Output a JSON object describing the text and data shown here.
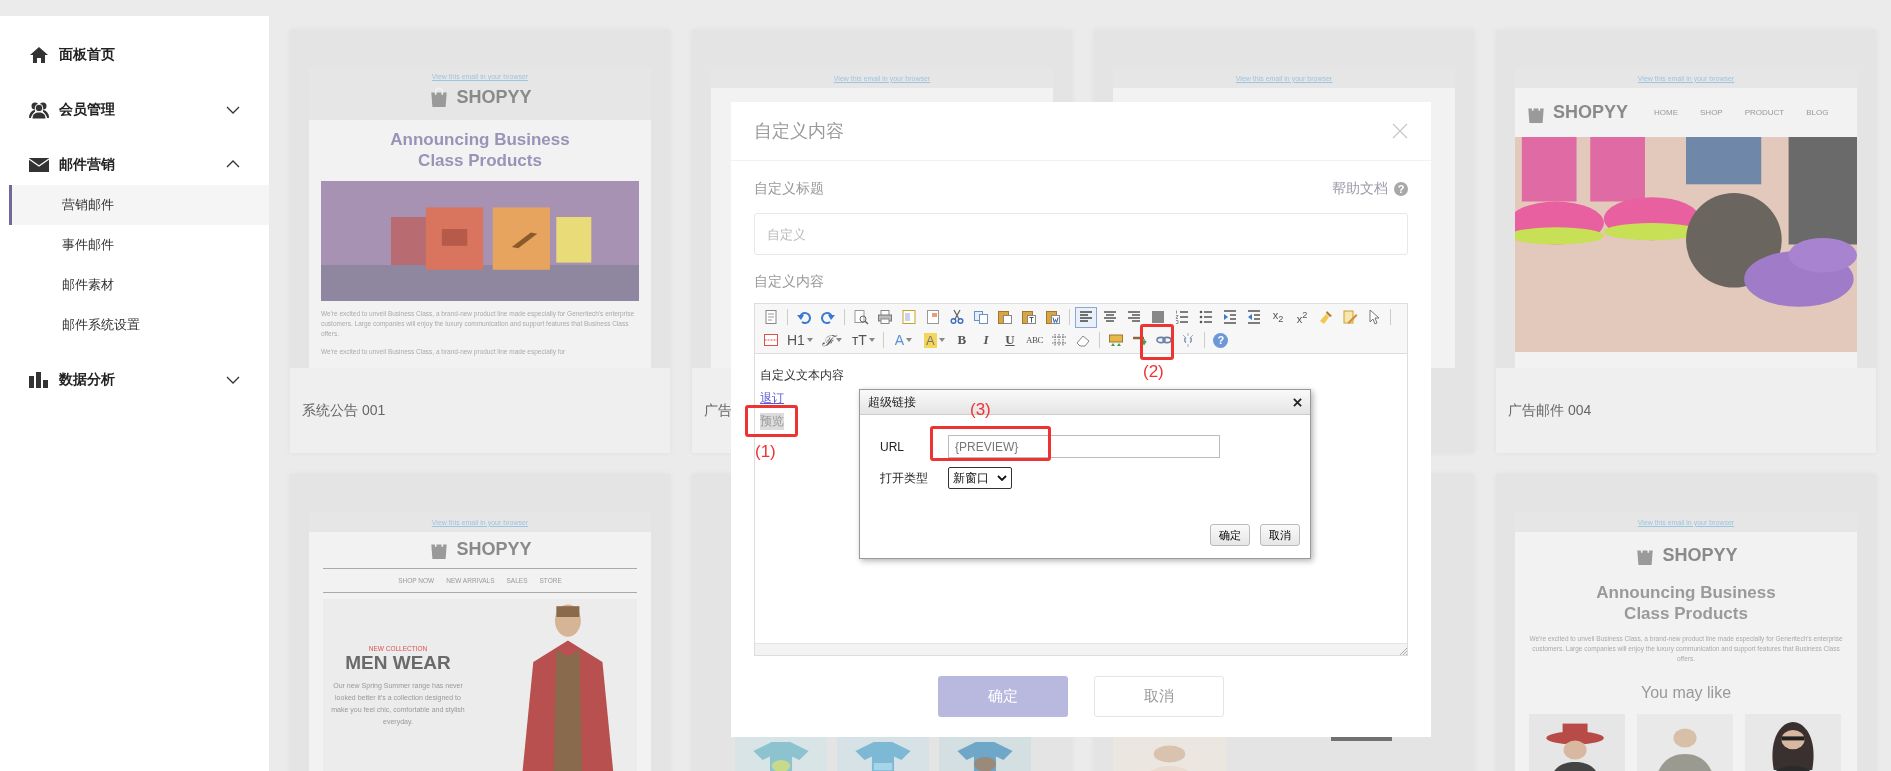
{
  "sidebar": {
    "items": [
      {
        "label": "面板首页"
      },
      {
        "label": "会员管理",
        "expanded": false
      },
      {
        "label": "邮件营销",
        "expanded": true,
        "children": [
          {
            "label": "营销邮件",
            "selected": true
          },
          {
            "label": "事件邮件",
            "selected": false
          },
          {
            "label": "邮件素材",
            "selected": false
          },
          {
            "label": "邮件系统设置",
            "selected": false
          }
        ]
      },
      {
        "label": "数据分析",
        "expanded": false
      }
    ]
  },
  "templates": [
    {
      "title": "系统公告 001",
      "preview": {
        "kind": "announcement",
        "browser_link": "View this email in your browser",
        "brand": "SHOPYY",
        "headline": "Announcing Business Class Products",
        "paragraphs": [
          "We're excited to unveil Business Class, a brand-new product line made especially for Generitech's enterprise customers. Large companies will enjoy the luxury communication and support features that Business Class offers.",
          "We're excited to unveil Business Class, a brand-new product line made especially for"
        ]
      }
    },
    {
      "title": "广告",
      "preview": {
        "kind": "header_only",
        "browser_link": "View this email in your browser"
      }
    },
    {
      "preview": {
        "kind": "header_only",
        "browser_link": "View this email in your browser"
      }
    },
    {
      "title": "广告邮件 004",
      "preview": {
        "kind": "nav_photo",
        "browser_link": "View this email in your browser",
        "brand": "SHOPYY",
        "nav": [
          "HOME",
          "SHOP",
          "PRODUCT",
          "BLOG"
        ]
      }
    },
    {
      "preview": {
        "kind": "fashion",
        "browser_link": "View this email in your browser",
        "brand": "SHOPYY",
        "nav": [
          "SHOP NOW",
          "NEW ARRIVALS",
          "SALES",
          "STORE"
        ],
        "tag": "NEW COLLECTION",
        "headline": "MEN WEAR",
        "body": "Our new Spring Summer range has never looked better it's a collection designed to make you feel chic, comfortable and stylish everyday."
      }
    },
    {
      "preview": {
        "kind": "photo_row"
      }
    },
    {
      "preview": {
        "kind": "photo_button"
      }
    },
    {
      "preview": {
        "kind": "recommend",
        "browser_link": "View this email in your browser",
        "brand": "SHOPYY",
        "headline": "Announcing Business Class Products",
        "paragraphs": [
          "We're excited to unveil Business Class, a brand-new product line made especially for Generitech's enterprise customers. Large companies will enjoy the luxury communication and support features that Business Class offers."
        ],
        "subhead": "You may like"
      }
    }
  ],
  "dialog": {
    "title": "自定义内容",
    "title_label": "自定义标题",
    "help_link": "帮助文档",
    "help_icon": "?",
    "title_input": {
      "placeholder": "自定义"
    },
    "content_label": "自定义内容",
    "toolbar": [
      [
        {
          "kind": "icon",
          "selected": false
        },
        {
          "kind": "separator"
        },
        {
          "kind": "icon",
          "selected": false
        },
        {
          "kind": "icon",
          "selected": false
        },
        {
          "kind": "separator"
        },
        {
          "kind": "icon",
          "selected": false
        },
        {
          "kind": "icon",
          "selected": false
        },
        {
          "kind": "icon",
          "selected": false
        },
        {
          "kind": "icon",
          "selected": false
        },
        {
          "kind": "icon",
          "selected": false
        },
        {
          "kind": "icon",
          "selected": false
        },
        {
          "kind": "icon",
          "selected": false
        },
        {
          "kind": "icon",
          "selected": false
        },
        {
          "kind": "icon",
          "selected": false
        },
        {
          "kind": "separator"
        },
        {
          "kind": "icon",
          "selected": true
        },
        {
          "kind": "icon",
          "selected": false
        },
        {
          "kind": "icon",
          "selected": false
        },
        {
          "kind": "icon",
          "selected": false
        },
        {
          "kind": "icon",
          "selected": false
        },
        {
          "kind": "icon",
          "selected": false
        },
        {
          "kind": "icon",
          "selected": false
        },
        {
          "kind": "icon",
          "selected": false
        },
        {
          "kind": "text",
          "label": "x$_{2}$"
        },
        {
          "kind": "text",
          "label": "x$^{2}$"
        },
        {
          "kind": "icon",
          "selected": false
        },
        {
          "kind": "icon",
          "selected": false
        },
        {
          "kind": "icon",
          "selected": false
        },
        {
          "kind": "separator"
        }
      ],
      [
        {
          "kind": "icon",
          "selected": false
        },
        {
          "kind": "text",
          "label": "H1",
          "dropdown": true
        },
        {
          "kind": "text",
          "label": "ℱ",
          "dropdown": true
        },
        {
          "kind": "text",
          "label": "ᴛT",
          "dropdown": true
        },
        {
          "kind": "separator"
        },
        {
          "kind": "text",
          "label": "A",
          "dropdown": true
        },
        {
          "kind": "text",
          "label": "A",
          "dropdown": true
        },
        {
          "kind": "text",
          "label": "B"
        },
        {
          "kind": "text",
          "label": "I"
        },
        {
          "kind": "text",
          "label": "U"
        },
        {
          "kind": "text",
          "label": "ABC"
        },
        {
          "kind": "icon",
          "selected": false
        },
        {
          "kind": "icon",
          "selected": false
        },
        {
          "kind": "separator"
        },
        {
          "kind": "icon",
          "selected": false
        },
        {
          "kind": "icon",
          "selected": false
        },
        {
          "kind": "icon",
          "selected": false
        },
        {
          "kind": "icon",
          "selected": false
        },
        {
          "kind": "separator"
        },
        {
          "kind": "text",
          "label": "?"
        }
      ]
    ],
    "content": [
      {
        "kind": "text",
        "text": "自定义文本内容",
        "selected": false
      },
      {
        "kind": "link",
        "text": "退订",
        "selected": false
      },
      {
        "kind": "text",
        "text": "预览",
        "selected": true
      }
    ],
    "buttons": [
      {
        "label": "确定",
        "kind": "primary"
      },
      {
        "label": "取消",
        "kind": "secondary"
      }
    ]
  },
  "link_dialog": {
    "title": "超级链接",
    "url_label": "URL",
    "url": "{PREVIEW}",
    "target_label": "打开类型",
    "target": "新窗口",
    "buttons": [
      "确定",
      "取消"
    ]
  },
  "annotations": [
    {
      "label": "(1)"
    },
    {
      "label": "(2)"
    },
    {
      "label": "(3)"
    }
  ]
}
